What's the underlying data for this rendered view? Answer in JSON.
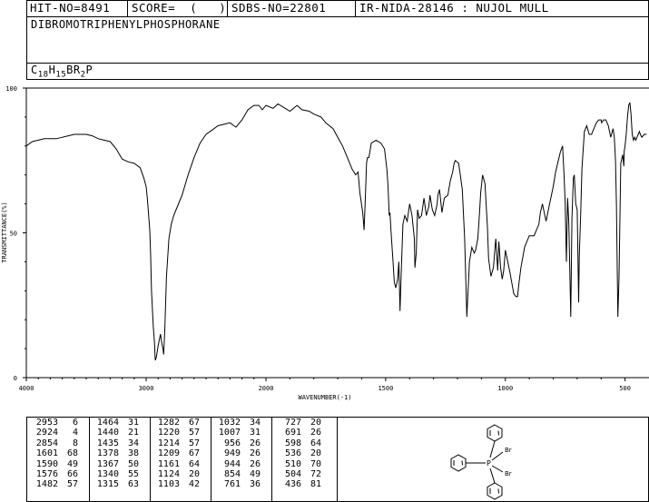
{
  "header": {
    "hit_no": "HIT-NO=8491",
    "score": "SCORE=  (   )",
    "sdbs_no": "SDBS-NO=22801",
    "ir_info": "IR-NIDA-28146 : NUJOL MULL"
  },
  "compound_name": "DIBROMOTRIPHENYLPHOSPHORANE",
  "formula": {
    "c": "C",
    "c_n": "18",
    "h": "H",
    "h_n": "15",
    "br": "BR",
    "br_n": "2",
    "p": "P"
  },
  "chart_data": {
    "type": "line",
    "xlabel": "WAVENUMBER(-1)",
    "ylabel": "TRANSMITTANCE(%)",
    "xlim": [
      4000,
      400
    ],
    "ylim": [
      0,
      100
    ],
    "x_ticks": [
      "4000",
      "3000",
      "2000",
      "1500",
      "1000",
      "500"
    ],
    "x_tick_values": [
      4000,
      3000,
      2000,
      1500,
      1000,
      500
    ],
    "y_ticks": [
      "0",
      "50",
      "100"
    ],
    "y_tick_values": [
      0,
      50,
      100
    ],
    "x": [
      4000,
      3950,
      3900,
      3850,
      3800,
      3750,
      3700,
      3650,
      3600,
      3550,
      3500,
      3450,
      3400,
      3350,
      3300,
      3250,
      3200,
      3150,
      3100,
      3050,
      3020,
      3000,
      2990,
      2970,
      2963,
      2955,
      2940,
      2930,
      2924,
      2915,
      2900,
      2880,
      2870,
      2860,
      2854,
      2845,
      2830,
      2810,
      2790,
      2770,
      2750,
      2700,
      2650,
      2600,
      2550,
      2500,
      2450,
      2400,
      2350,
      2300,
      2250,
      2200,
      2150,
      2100,
      2060,
      2030,
      2000,
      1970,
      1950,
      1920,
      1900,
      1870,
      1850,
      1820,
      1800,
      1770,
      1750,
      1720,
      1700,
      1680,
      1660,
      1640,
      1625,
      1615,
      1608,
      1601,
      1596,
      1590,
      1585,
      1580,
      1576,
      1570,
      1560,
      1540,
      1520,
      1505,
      1495,
      1490,
      1485,
      1482,
      1477,
      1470,
      1464,
      1458,
      1450,
      1445,
      1440,
      1435,
      1428,
      1420,
      1410,
      1400,
      1390,
      1380,
      1378,
      1372,
      1367,
      1360,
      1350,
      1340,
      1330,
      1320,
      1315,
      1305,
      1295,
      1285,
      1282,
      1275,
      1265,
      1255,
      1240,
      1230,
      1220,
      1214,
      1209,
      1195,
      1180,
      1170,
      1161,
      1150,
      1140,
      1130,
      1124,
      1115,
      1108,
      1103,
      1095,
      1085,
      1075,
      1070,
      1060,
      1050,
      1040,
      1032,
      1027,
      1020,
      1013,
      1007,
      1000,
      990,
      980,
      965,
      956,
      949,
      944,
      935,
      920,
      900,
      880,
      860,
      854,
      845,
      830,
      815,
      800,
      790,
      770,
      761,
      755,
      750,
      745,
      740,
      735,
      731,
      727,
      722,
      716,
      712,
      706,
      700,
      694,
      691,
      686,
      680,
      670,
      660,
      650,
      640,
      630,
      620,
      610,
      600,
      598,
      590,
      580,
      570,
      560,
      550,
      545,
      540,
      536,
      530,
      525,
      518,
      510,
      505,
      504,
      500,
      495,
      490,
      485,
      480,
      475,
      470,
      465,
      460,
      455,
      450,
      445,
      440,
      436,
      430,
      420,
      410,
      400
    ],
    "y": [
      80,
      81.5,
      82,
      82.5,
      82.5,
      82.5,
      83,
      83.5,
      84,
      84,
      84,
      83.5,
      82.5,
      82,
      81.5,
      79,
      75.5,
      74.5,
      74,
      72.5,
      69,
      66,
      62,
      51,
      43,
      30,
      17.5,
      12,
      6,
      7,
      11,
      15,
      12,
      10,
      8,
      16,
      35,
      48,
      53,
      56,
      58,
      63,
      70,
      76,
      81,
      84,
      85.5,
      87,
      87.5,
      88,
      86.5,
      89,
      92.5,
      94,
      94,
      92.5,
      94,
      93,
      94.5,
      93,
      92,
      94,
      92.5,
      92,
      91,
      90,
      88,
      86,
      83,
      80,
      76,
      72,
      70,
      71,
      64,
      60,
      57,
      51,
      62,
      74,
      76,
      76,
      81,
      82,
      81,
      79,
      72,
      66,
      56,
      57,
      50,
      41,
      33,
      31,
      34,
      40,
      23,
      36,
      53,
      56,
      54,
      60,
      56,
      48,
      38,
      43,
      58,
      55,
      56,
      62,
      56,
      59,
      63,
      58,
      56,
      60,
      63,
      65,
      57,
      62,
      63,
      68,
      71,
      74,
      75,
      74,
      65,
      48,
      21,
      40,
      45,
      43,
      44,
      48,
      57,
      64,
      70,
      67,
      52,
      41,
      35,
      38,
      48,
      37,
      47,
      38,
      34,
      37,
      44,
      40,
      36,
      29,
      28,
      28,
      32,
      38,
      45,
      49,
      49,
      53,
      57,
      60,
      54,
      60,
      66,
      71,
      78,
      80,
      70,
      60,
      40,
      62,
      54,
      38,
      21,
      55,
      69,
      70,
      60,
      58,
      26,
      42,
      55,
      72,
      85,
      87,
      84,
      84,
      86,
      88,
      89,
      89,
      88,
      89,
      89,
      87,
      83,
      86,
      83,
      75,
      60,
      21,
      35,
      74,
      77,
      73,
      78,
      80,
      84,
      90,
      94,
      95,
      91,
      84,
      82,
      83,
      82,
      83,
      84,
      85,
      84,
      83,
      84,
      84
    ]
  },
  "peak_table": {
    "columns": [
      [
        [
          "2953",
          "6"
        ],
        [
          "2924",
          "4"
        ],
        [
          "2854",
          "8"
        ],
        [
          "1601",
          "68"
        ],
        [
          "1590",
          "49"
        ],
        [
          "1576",
          "66"
        ],
        [
          "1482",
          "57"
        ]
      ],
      [
        [
          "1464",
          "31"
        ],
        [
          "1440",
          "21"
        ],
        [
          "1435",
          "34"
        ],
        [
          "1378",
          "38"
        ],
        [
          "1367",
          "50"
        ],
        [
          "1340",
          "55"
        ],
        [
          "1315",
          "63"
        ]
      ],
      [
        [
          "1282",
          "67"
        ],
        [
          "1220",
          "57"
        ],
        [
          "1214",
          "57"
        ],
        [
          "1209",
          "67"
        ],
        [
          "1161",
          "64"
        ],
        [
          "1124",
          "20"
        ],
        [
          "1103",
          "42"
        ]
      ],
      [
        [
          "1032",
          "34"
        ],
        [
          "1007",
          "31"
        ],
        [
          "956",
          "26"
        ],
        [
          "949",
          "26"
        ],
        [
          "944",
          "26"
        ],
        [
          "854",
          "49"
        ],
        [
          "761",
          "36"
        ]
      ],
      [
        [
          "727",
          "20"
        ],
        [
          "691",
          "26"
        ],
        [
          "598",
          "64"
        ],
        [
          "536",
          "20"
        ],
        [
          "510",
          "70"
        ],
        [
          "504",
          "72"
        ],
        [
          "436",
          "81"
        ]
      ]
    ]
  },
  "structure": {
    "atom_br_top": "Br",
    "atom_br_bottom": "Br",
    "atom_p": "P"
  }
}
